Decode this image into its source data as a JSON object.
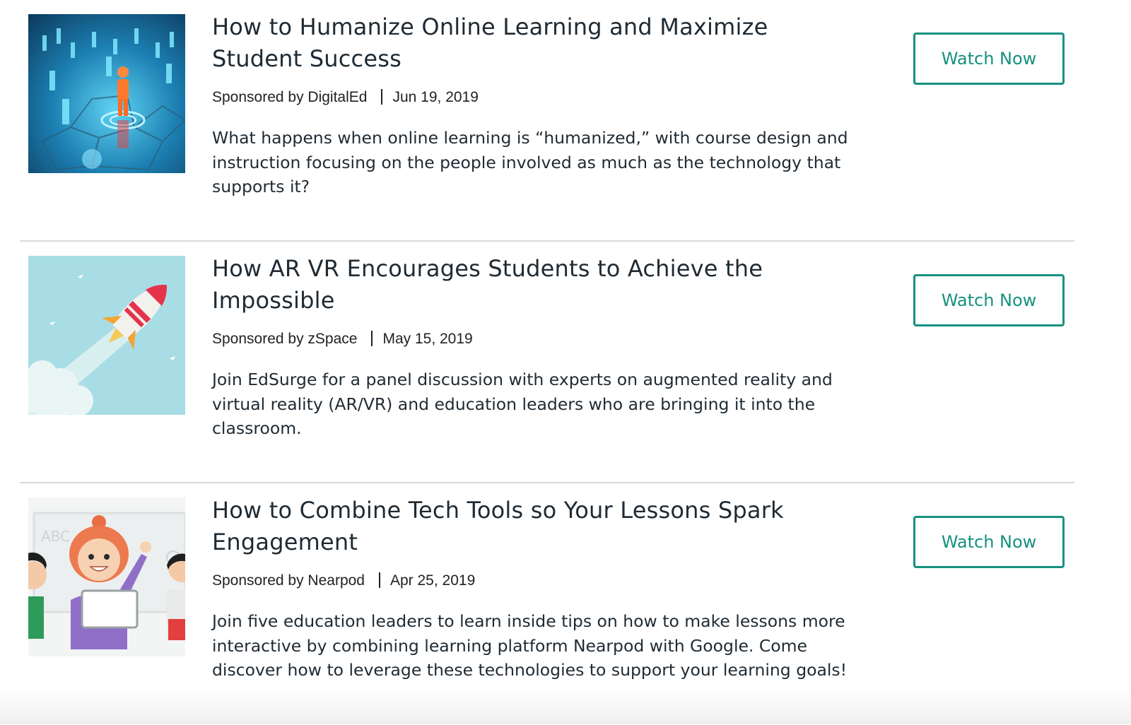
{
  "webinars": [
    {
      "title": "How to Humanize Online Learning and Maximize Student Success",
      "sponsor": "Sponsored by DigitalEd",
      "date": "Jun 19, 2019",
      "description": "What happens when online learning is “humanized,” with course design and instruction focusing on the people involved as much as the technology that supports it?",
      "button_label": "Watch Now",
      "thumbnail_icon": "network-people-icon"
    },
    {
      "title": "How AR VR Encourages Students to Achieve the Impossible",
      "sponsor": "Sponsored by zSpace",
      "date": "May 15, 2019",
      "description": "Join EdSurge for a panel discussion with experts on augmented reality and virtual reality (AR/VR) and education leaders who are bringing it into the classroom.",
      "button_label": "Watch Now",
      "thumbnail_icon": "rocket-icon"
    },
    {
      "title": "How to Combine Tech Tools so Your Lessons Spark Engagement",
      "sponsor": "Sponsored by Nearpod",
      "date": "Apr 25, 2019",
      "description": "Join five education leaders to learn inside tips on how to make lessons more interactive by combining learning platform Nearpod with Google. Come discover how to leverage these technologies to support your learning goals!",
      "button_label": "Watch Now",
      "thumbnail_icon": "classroom-students-icon",
      "board_text": "ABC"
    }
  ],
  "colors": {
    "accent": "#16917f",
    "text": "#1f2a33",
    "divider": "#d6d9dc"
  }
}
